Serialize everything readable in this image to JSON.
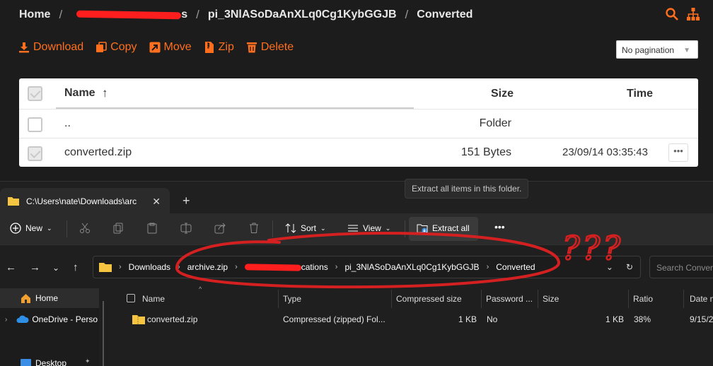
{
  "web": {
    "breadcrumbs": [
      "Home",
      "pi_3NlASoDaAnXLq0Cg1KybGGJB",
      "Converted"
    ],
    "breadcrumb_redacted_tail": "s",
    "actions": {
      "download": "Download",
      "copy": "Copy",
      "move": "Move",
      "zip": "Zip",
      "delete": "Delete"
    },
    "pagination": "No pagination",
    "table": {
      "headers": {
        "name": "Name",
        "size": "Size",
        "time": "Time"
      },
      "rows": [
        {
          "name": "..",
          "size": "Folder",
          "time": ""
        },
        {
          "name": "converted.zip",
          "size": "151 Bytes",
          "time": "23/09/14 03:35:43",
          "more": "•••"
        }
      ]
    },
    "accent": "#ff6f1e"
  },
  "explorer": {
    "tab_title": "C:\\Users\\nate\\Downloads\\arc",
    "tooltip": "Extract all items in this folder.",
    "commands": {
      "new": "New",
      "sort": "Sort",
      "view": "View",
      "extract_all": "Extract all",
      "more": "•••"
    },
    "address": {
      "downloads": "Downloads",
      "archive": "archive.zip",
      "redacted_tail": "cations",
      "pi": "pi_3NlASoDaAnXLq0Cg1KybGGJB",
      "converted": "Converted"
    },
    "search_placeholder": "Search Convert",
    "sidebar": {
      "home": "Home",
      "onedrive": "OneDrive - Perso",
      "desktop": "Desktop"
    },
    "columns": {
      "name": "Name",
      "type": "Type",
      "compressed": "Compressed size",
      "password": "Password ...",
      "size": "Size",
      "ratio": "Ratio",
      "date": "Date m"
    },
    "file": {
      "name": "converted.zip",
      "type": "Compressed (zipped) Fol...",
      "compressed": "1 KB",
      "password": "No",
      "size": "1 KB",
      "ratio": "38%",
      "date": "9/15/2"
    }
  },
  "annotation": {
    "marks": "???",
    "color": "#d42020"
  }
}
